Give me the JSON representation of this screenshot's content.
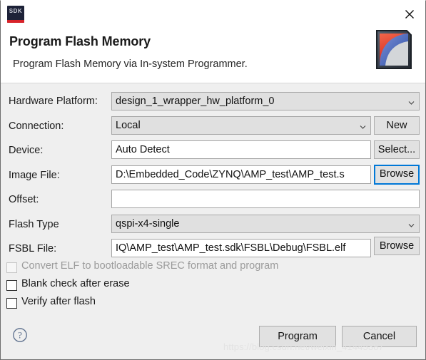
{
  "window": {
    "app_icon_label": "SDK",
    "close_label": "✕",
    "title": "Program Flash Memory",
    "subtitle": "Program Flash Memory via In-system Programmer.",
    "brand_logo_name": "xilinx-sdk-logo"
  },
  "form": {
    "rows": [
      {
        "label": "Hardware Platform:",
        "value": "design_1_wrapper_hw_platform_0",
        "type": "combo",
        "state": "readonly",
        "button": null
      },
      {
        "label": "Connection:",
        "value": "Local",
        "type": "combo",
        "state": "readonly",
        "button": "New"
      },
      {
        "label": "Device:",
        "value": "Auto Detect",
        "type": "text",
        "state": "normal",
        "button": "Select..."
      },
      {
        "label": "Image File:",
        "value": "D:\\Embedded_Code\\ZYNQ\\AMP_test\\AMP_test.s",
        "type": "text",
        "state": "normal",
        "button": "Browse",
        "button_focused": true
      },
      {
        "label": "Offset:",
        "value": "",
        "type": "text",
        "state": "normal",
        "button": null
      },
      {
        "label": "Flash Type",
        "value": "qspi-x4-single",
        "type": "combo",
        "state": "readonly",
        "button": null
      },
      {
        "label": "FSBL File:",
        "value": "IQ\\AMP_test\\AMP_test.sdk\\FSBL\\Debug\\FSBL.elf",
        "type": "text",
        "state": "normal",
        "button": "Browse"
      }
    ]
  },
  "checkboxes": [
    {
      "label": "Convert ELF to bootloadable SREC format and program",
      "checked": false,
      "enabled": false
    },
    {
      "label": "Blank check after erase",
      "checked": false,
      "enabled": true
    },
    {
      "label": "Verify after flash",
      "checked": false,
      "enabled": true
    }
  ],
  "footer": {
    "help_label": "?",
    "program_label": "Program",
    "cancel_label": "Cancel",
    "watermark": "https://blog.csdn.net/weixin_41445387"
  },
  "colors": {
    "dialog_bg": "#efefef",
    "header_bg": "#ffffff",
    "focus_blue": "#0078d7",
    "sdk_navy": "#1d2238",
    "sdk_red": "#d8232a"
  }
}
